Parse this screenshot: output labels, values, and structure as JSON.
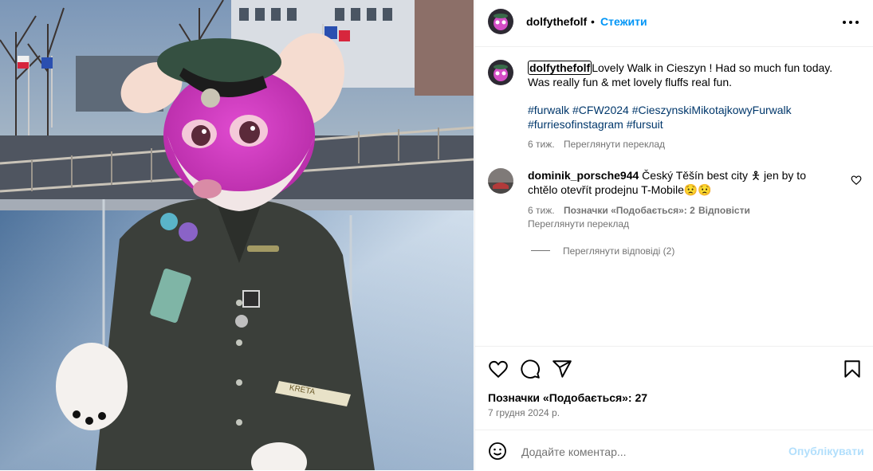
{
  "post": {
    "image_alt": "photo",
    "image_text": "KRETA"
  },
  "header": {
    "username": "dolfythefolf",
    "separator": "•",
    "follow_label": "Стежити",
    "more_icon": "more-horizontal-icon"
  },
  "caption": {
    "username": "dolfythefolf",
    "text": "Lovely Walk in Cieszyn ! Had so much fun today. Was really fun & met lovely fluffs real fun.",
    "hashtags": "#furwalk #CFW2024 #CieszynskiMikotajkowyFurwalk #furriesofinstagram #fursuit",
    "time": "6 тиж.",
    "translate_label": "Переглянути переклад"
  },
  "comment": {
    "username": "dominik_porsche944",
    "text": "Český Těšín best city 🯅 jen by to chtělo otevřít prodejnu T-Mobile😟😟",
    "time": "6 тиж.",
    "likes_label": "Позначки «Подобається»: 2",
    "reply_label": "Відповісти",
    "translate_label": "Переглянути переклад",
    "view_replies_label": "Переглянути відповіді (2)"
  },
  "actions": {
    "like_icon": "heart-icon",
    "comment_icon": "comment-icon",
    "share_icon": "share-icon",
    "save_icon": "bookmark-icon",
    "likes_text": "Позначки «Подобається»: 27",
    "date": "7 грудня 2024 р."
  },
  "composer": {
    "emoji_icon": "emoji-icon",
    "placeholder": "Додайте коментар...",
    "value": "",
    "publish_label": "Опублікувати"
  },
  "colors": {
    "link_blue": "#0095f6",
    "hashtag_blue": "#00376b",
    "secondary_text": "#737373",
    "publish_disabled": "#b2dffc"
  }
}
